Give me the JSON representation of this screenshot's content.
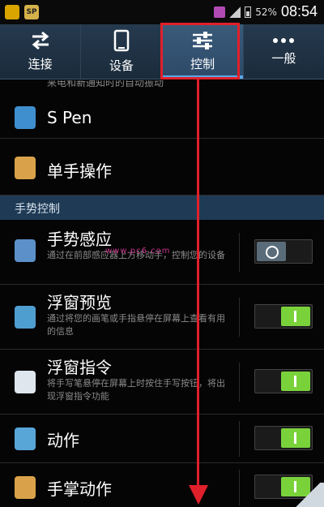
{
  "statusbar": {
    "battery": "52%",
    "time": "08:54",
    "app_badge": "SP"
  },
  "tabs": [
    {
      "label": "连接",
      "icon": "swap-arrows-icon",
      "active": false
    },
    {
      "label": "设备",
      "icon": "phone-icon",
      "active": false
    },
    {
      "label": "控制",
      "icon": "sliders-icon",
      "active": true
    },
    {
      "label": "一般",
      "icon": "more-dots-icon",
      "active": false
    }
  ],
  "list": {
    "partial_text": "来电和新通知时的自动振动",
    "spen": {
      "title": "S Pen"
    },
    "onehand": {
      "title": "单手操作"
    },
    "section_title": "手势控制",
    "gesture": {
      "title": "手势感应",
      "sub": "通过在前部感应器上方移动手，控制您的设备",
      "toggle": "off"
    },
    "float_preview": {
      "title": "浮窗预览",
      "sub": "通过将您的画笔或手指悬停在屏幕上查看有用的信息",
      "toggle": "on"
    },
    "float_cmd": {
      "title": "浮窗指令",
      "sub": "将手写笔悬停在屏幕上时按住手写按钮，将出现浮窗指令功能",
      "toggle": "on"
    },
    "motion": {
      "title": "动作",
      "toggle": "on"
    },
    "palm": {
      "title": "手掌动作",
      "toggle": "on"
    }
  },
  "watermark": "www.pc6.com",
  "colors": {
    "accent": "#7ad23b",
    "highlight": "#e0202a",
    "tab_bg": "#263a4f",
    "section_bg": "#1f3a55"
  }
}
